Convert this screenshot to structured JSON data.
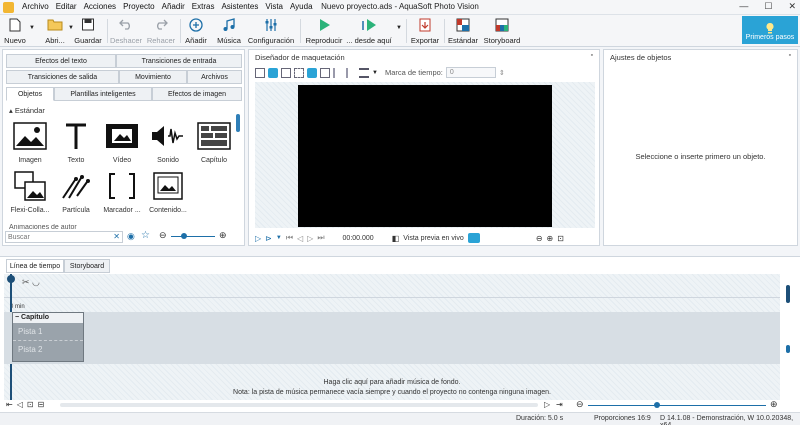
{
  "window": {
    "title": "Nuevo proyecto.ads - AquaSoft Photo Vision",
    "minimize": "—",
    "maximize": "☐",
    "close": "✕"
  },
  "menu": [
    "Archivo",
    "Editar",
    "Acciones",
    "Proyecto",
    "Añadir",
    "Extras",
    "Asistentes",
    "Vista",
    "Ayuda"
  ],
  "toolbar": {
    "nuevo": "Nuevo",
    "abrir": "Abri...",
    "guardar": "Guardar",
    "deshacer": "Deshacer",
    "rehacer": "Rehacer",
    "anadir": "Añadir",
    "musica": "Música",
    "configuracion": "Configuración",
    "reproducir": "Reproducir",
    "desde_aqui": "... desde aquí",
    "exportar": "Exportar",
    "estandar": "Estándar",
    "storyboard": "Storyboard",
    "primeros_pasos": "Primeros pasos"
  },
  "left_panel": {
    "tabs_row1": [
      "Efectos del texto",
      "Transiciones de entrada"
    ],
    "tabs_row2": [
      "Transiciones de salida",
      "Movimiento",
      "Archivos"
    ],
    "tabs_row3": [
      "Objetos",
      "Plantillas inteligentes",
      "Efectos de imagen"
    ],
    "section_standard": "Estándar",
    "objects": [
      "Imagen",
      "Texto",
      "Vídeo",
      "Sonido",
      "Capítulo",
      "Flexi-Colla...",
      "Partícula",
      "Marcador ...",
      "Contenido..."
    ],
    "section_next": "Animaciones de autor",
    "search_placeholder": "Buscar"
  },
  "designer": {
    "title": "Diseñador de maquetación",
    "marca_label": "Marca de tiempo:",
    "marca_value": "0",
    "time": "00:00.000",
    "preview_label": "Vista previa en vivo"
  },
  "settings": {
    "title": "Ajustes de objetos",
    "hint": "Seleccione o inserte primero un objeto."
  },
  "timeline": {
    "tabs": [
      "Línea de tiempo",
      "Storyboard"
    ],
    "min_label": "0 min",
    "chapter_label": "Capítulo",
    "tracks": [
      "Pista 1",
      "Pista 2"
    ],
    "music_hint_1": "Haga clic aquí para añadir música de fondo.",
    "music_hint_2": "Nota: la pista de música permanece vacía siempre y cuando el proyecto no contenga ninguna imagen."
  },
  "status": {
    "duration": "Duración: 5.0 s",
    "proportions": "Proporciones 16:9",
    "version": "D 14.1.08 - Demonstración, W 10.0.20348, x64"
  },
  "colors": {
    "accent": "#2aa3d6",
    "preview_bg": "#000000",
    "chapter_bg": "#9aa3ab"
  }
}
